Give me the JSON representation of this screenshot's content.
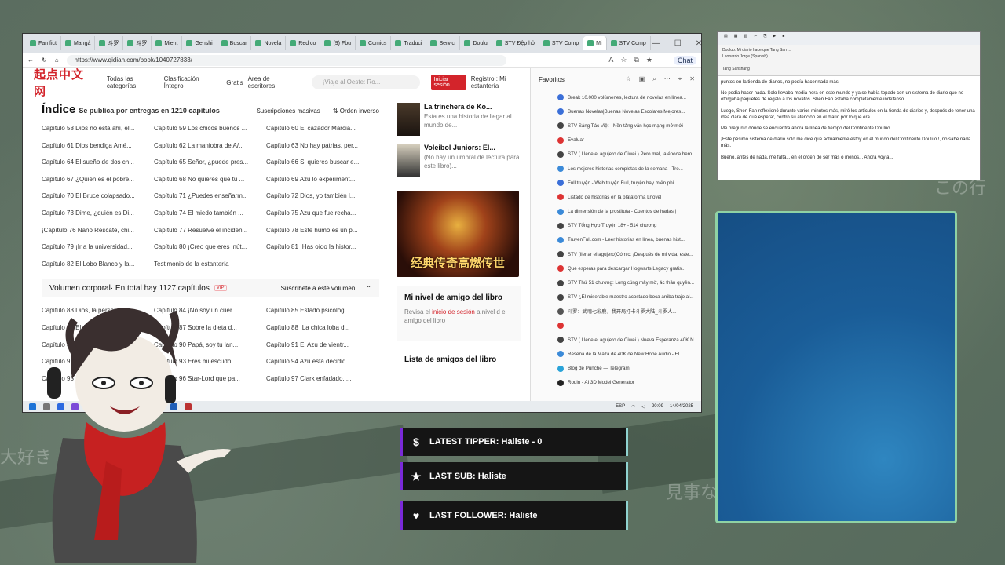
{
  "browser": {
    "tabs": [
      "Fan fict",
      "Mangá",
      "斗罗",
      "斗罗",
      "Mient",
      "Genshi",
      "Buscar",
      "Novela",
      "Red co",
      "(9) Fbu",
      "Comics",
      "Traduci",
      "Servici",
      "Doulu",
      "STV Đệp hỏ",
      "STV Comp",
      "Mi",
      "STV Comp"
    ],
    "url": "https://www.qidian.com/book/1040727833/",
    "chat_label": "Chat"
  },
  "site": {
    "logo": "起点中文网",
    "nav": [
      "Todas las categorías",
      "Clasificación Íntegro",
      "Gratis",
      "Área de escritores"
    ],
    "search_placeholder": "¡Viaje al Oeste: Ro...",
    "login_button": "Iniciar sesión",
    "register_link": "Registro : Mi estantería",
    "index_title": "Índice",
    "index_subtitle": "Se publica por entregas en 1210 capítulos",
    "mass_subscriptions": "Suscripciones masivas",
    "reverse_order": "Orden inverso",
    "chapters": [
      "Capítulo 58 Dios no está ahí, el...",
      "Capítulo 59 Los chicos buenos ...",
      "Capítulo 60 El cazador Marcia...",
      "Capítulo 61 Dios bendiga Amé...",
      "Capítulo 62 La maniobra de A/...",
      "Capítulo 63 No hay patrias, per...",
      "Capítulo 64 El sueño de dos ch...",
      "Capítulo 65 Señor, ¿puede pres...",
      "Capítulo 66 Si quieres buscar e...",
      "Capítulo 67 ¿Quién es el pobre...",
      "Capítulo 68 No quieres que tu ...",
      "Capítulo 69 Azu lo experiment...",
      "Capítulo 70 El Bruce colapsado...",
      "Capítulo 71 ¿Puedes enseñarm...",
      "Capítulo 72 Dios, yo también l...",
      "Capítulo 73 Dime, ¿quién es Di...",
      "Capítulo 74 El miedo también ...",
      "Capítulo 75 Azu que fue recha...",
      "¡Capítulo 76 Nano Rescate, chi...",
      "Capítulo 77 Resuelve el inciden...",
      "Capítulo 78 Este humo es un p...",
      "Capítulo 79 ¡Ir a la universidad...",
      "Capítulo 80 ¡Creo que eres inút...",
      "Capítulo 81 ¡Has oído la histor...",
      "Capítulo 82 El Lobo Blanco y la...",
      "Testimonio de la estantería",
      ""
    ],
    "volume_title": "Volumen corporal· En total hay 1127 capítulos",
    "volume_vip": "VIP",
    "volume_subscribe": "Suscríbete a este volumen",
    "chapters2": [
      "Capítulo 83 Dios, la persona...",
      "Capítulo 84 ¡No soy un cuer...",
      "Capítulo 85 Estado psicológi...",
      "Capítulo 86 El Amo...",
      "Capítulo 87 Sobre la dieta d...",
      "Capítulo 88 ¡La chica loba d...",
      "Capítulo 89 ...",
      "Capítulo 90 Papá, soy tu lan...",
      "Capítulo 91 El Azu de vientr...",
      "Capítulo 92 ...",
      "Capítulo 93 Eres mi escudo, ...",
      "Capítulo 94 Azu está decidid...",
      "Capítulo 95 ...",
      "Capítulo 96 Star-Lord que pa...",
      "Capítulo 97 Clark enfadado, ..."
    ],
    "books": [
      {
        "title": "La trinchera de Ko...",
        "desc": "Esta es una historia de llegar al mundo de..."
      },
      {
        "title": "Voleibol Juniors: El...",
        "desc": "(No hay un umbral de lectura para este libro)..."
      }
    ],
    "banner_text": "经典传奇高燃传世",
    "friend_title": "Mi nivel de amigo del libro",
    "friend_desc_pre": "Revisa el",
    "friend_desc_link": "inicio de sesión",
    "friend_desc_post": "a nivel d e amigo del libro",
    "friend_list": "Lista de amigos del libro"
  },
  "favorites": {
    "title": "Favoritos",
    "items": [
      {
        "label": "Break 10.000 volúmenes, lectura de novelas en línea...",
        "color": "#3b6fd8"
      },
      {
        "label": "Buenas Novelas|Buenas Novelas Escolares|Mejores...",
        "color": "#3b6fd8"
      },
      {
        "label": "STV Sáng Tác Việt - Nền tảng văn học mạng mở mới",
        "color": "#444444"
      },
      {
        "label": "Evaluar",
        "color": "#d33"
      },
      {
        "label": "STV ( Llene el agujero de Ciwei ) Pero mal, la época hero...",
        "color": "#444444"
      },
      {
        "label": "Los mejores historias completas de la semana - Tro...",
        "color": "#3b8ad8"
      },
      {
        "label": "Full truyện - Web truyện Full, truyện hay miễn phí",
        "color": "#3b6fd8"
      },
      {
        "label": "Listado de historias en la plataforma Lnovel",
        "color": "#d33"
      },
      {
        "label": "La dimensión de la prostituta - Cuentos de hadas |",
        "color": "#3b8ad8"
      },
      {
        "label": "STV Tổng Hợp Truyện 18+ - 514 chương",
        "color": "#444444"
      },
      {
        "label": "TruyenFull.com - Leer historias en línea, buenas hist...",
        "color": "#3b8ad8"
      },
      {
        "label": "STV (llenar el agujero)Cómic: ¡Después de mi vida, este...",
        "color": "#444444"
      },
      {
        "label": "Qué esperas para descargar Hogwarts Legacy gratis...",
        "color": "#d33"
      },
      {
        "label": "STV Thứ 51 chương: Lòng cúng mây mờ, ác thần quyền...",
        "color": "#444444"
      },
      {
        "label": "STV ¿El miserable maestro acostado boca arriba trajo al...",
        "color": "#444444"
      },
      {
        "label": "斗罗：武魂七彩鹿，我开局打卡斗罗大陆_斗罗人...",
        "color": "#555555"
      },
      {
        "label": "",
        "color": "#d33"
      },
      {
        "label": "STV ( Llene el agujero de Ciwei ) Nueva Esperanza 40K N...",
        "color": "#444444"
      },
      {
        "label": "Reseña de la Maza de 40K de New Hope Audio - El...",
        "color": "#3b8ad8"
      },
      {
        "label": "Blog de Punche — Telegram",
        "color": "#2aa3d8"
      },
      {
        "label": "Rodin - AI 3D Model Generator",
        "color": "#222222"
      }
    ]
  },
  "taskbar": {
    "lang": "ESP",
    "time": "20:09",
    "date": "14/04/2025"
  },
  "doc": {
    "title_field": "Douluo: Mi diario hace que Tang San ...",
    "voice_field": "Leonardo Jorge (Spanish)",
    "author_line": "Tang Sanshang",
    "paragraphs": [
      "puntos en la tienda de diarios, no podía hacer nada más.",
      "No podía hacer nada. Solo llevaba media hora en este mundo y ya se había topado con un sistema de diario que no otorgaba paquetes de regalo a los novatos. Shen Fan estaba completamente indefenso.",
      "Luego, Shen Fan reflexionó durante varios minutos más, miró los artículos en la tienda de diarios y, después de tener una idea clara de qué esperar, centró su atención en el diario por lo que era.",
      "Me pregunto dónde se encuentra ahora la línea de tiempo del Continente Douluo.",
      "¡Este pésimo sistema de diario solo me dice que actualmente estoy en el mundo del Continente Douluo !, no sabe nada más.",
      "Bueno, antes de nada, me falta... en el orden de ser más o menos... Ahora voy a..."
    ]
  },
  "alerts": [
    {
      "icon": "dollar-icon",
      "glyph": "$",
      "label": "LATEST TIPPER: Haliste - 0"
    },
    {
      "icon": "star-icon",
      "glyph": "★",
      "label": "LAST SUB: Haliste"
    },
    {
      "icon": "heart-icon",
      "glyph": "♥",
      "label": "LAST FOLLOWER: Haliste"
    }
  ],
  "deco": [
    "大好き",
    "この行",
    "見事な"
  ]
}
